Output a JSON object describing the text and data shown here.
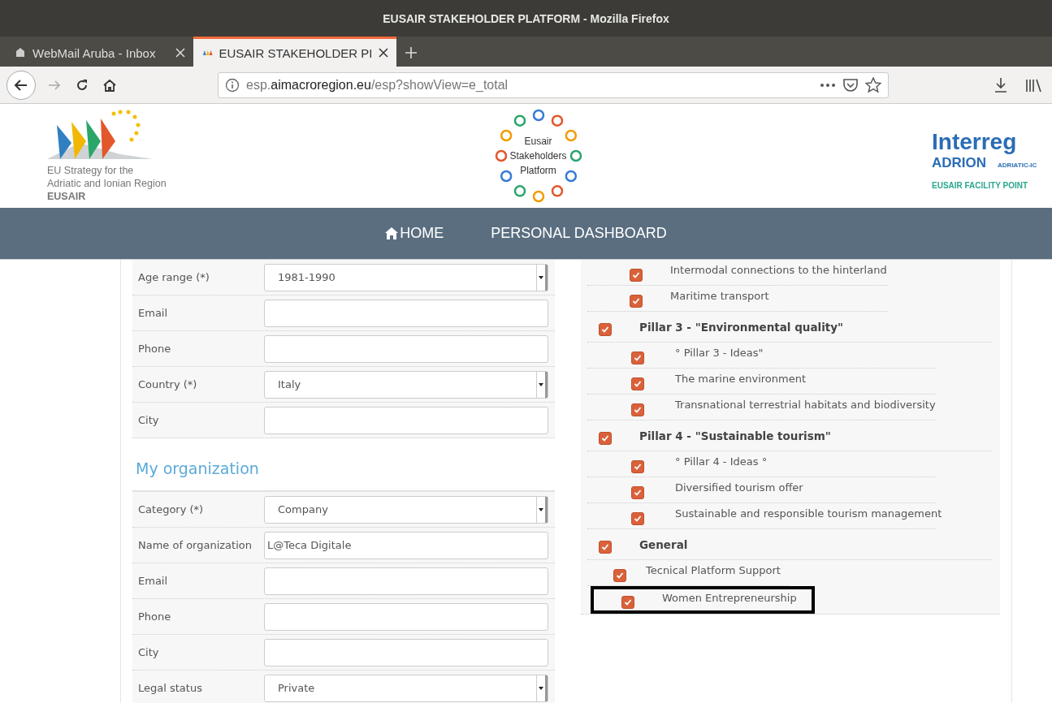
{
  "window": {
    "title": "EUSAIR STAKEHOLDER PLATFORM - Mozilla Firefox"
  },
  "tabs": [
    {
      "label": "WebMail Aruba - Inbox",
      "selected": false
    },
    {
      "label": "EUSAIR STAKEHOLDER PI",
      "selected": true
    }
  ],
  "address": {
    "prefix": "esp.",
    "domain": "aimacroregion.eu",
    "path": "/esp?showView=e_total"
  },
  "header": {
    "left_logo": [
      "EU Strategy for the",
      "Adriatic and Ionian Region",
      "EUSAIR"
    ],
    "center_logo": [
      "Eusair",
      "Stakeholders",
      "Platform"
    ],
    "right_logo": {
      "brand": "Interreg",
      "program": "ADRION",
      "tagline": "ADRIATIC-IC",
      "facility": "EUSAIR FACILITY POINT"
    }
  },
  "nav": [
    {
      "label": "HOME",
      "kind": "home"
    },
    {
      "label": "PERSONAL DASHBOARD",
      "kind": "plain"
    }
  ],
  "personal_fields": [
    {
      "label": "Age range (*)",
      "kind": "select",
      "value": "1981-1990"
    },
    {
      "label": "Email",
      "kind": "text"
    },
    {
      "label": "Phone",
      "kind": "text"
    },
    {
      "label": "Country (*)",
      "kind": "select",
      "value": "Italy"
    },
    {
      "label": "City",
      "kind": "text"
    }
  ],
  "organization": {
    "title": "My organization",
    "fields": [
      {
        "label": "Category (*)",
        "kind": "select",
        "value": "Company"
      },
      {
        "label": "Name of organization",
        "kind": "text",
        "value": "L@Teca Digitale"
      },
      {
        "label": "Email",
        "kind": "text"
      },
      {
        "label": "Phone",
        "kind": "text"
      },
      {
        "label": "City",
        "kind": "text"
      },
      {
        "label": "Legal status",
        "kind": "select",
        "value": "Private"
      }
    ]
  },
  "interests": {
    "leading_items": [
      {
        "label": "Intermodal connections to the hinterland",
        "checked": true,
        "highlighted": false
      },
      {
        "label": "Maritime transport",
        "checked": true,
        "highlighted": false
      }
    ],
    "groups": [
      {
        "title": "Pillar 3 - \"Environmental quality\"",
        "checked": true,
        "children": [
          {
            "label": "° Pillar 3 - Ideas\"",
            "checked": true,
            "highlighted": false
          },
          {
            "label": "The marine environment",
            "checked": true,
            "highlighted": false
          },
          {
            "label": "Transnational terrestrial habitats and biodiversity",
            "checked": true,
            "highlighted": false
          }
        ]
      },
      {
        "title": "Pillar 4 - \"Sustainable tourism\"",
        "checked": true,
        "children": [
          {
            "label": "° Pillar 4 - Ideas °",
            "checked": true,
            "highlighted": false
          },
          {
            "label": "Diversified tourism offer",
            "checked": true,
            "highlighted": false
          },
          {
            "label": "Sustainable and responsible tourism management",
            "checked": true,
            "highlighted": false
          }
        ]
      },
      {
        "title": "General",
        "checked": true,
        "children": [
          {
            "label": "Tecnical Platform Support",
            "checked": true,
            "highlighted": false
          },
          {
            "label": "Women Entrepreneurship",
            "checked": true,
            "highlighted": true
          }
        ]
      }
    ]
  }
}
